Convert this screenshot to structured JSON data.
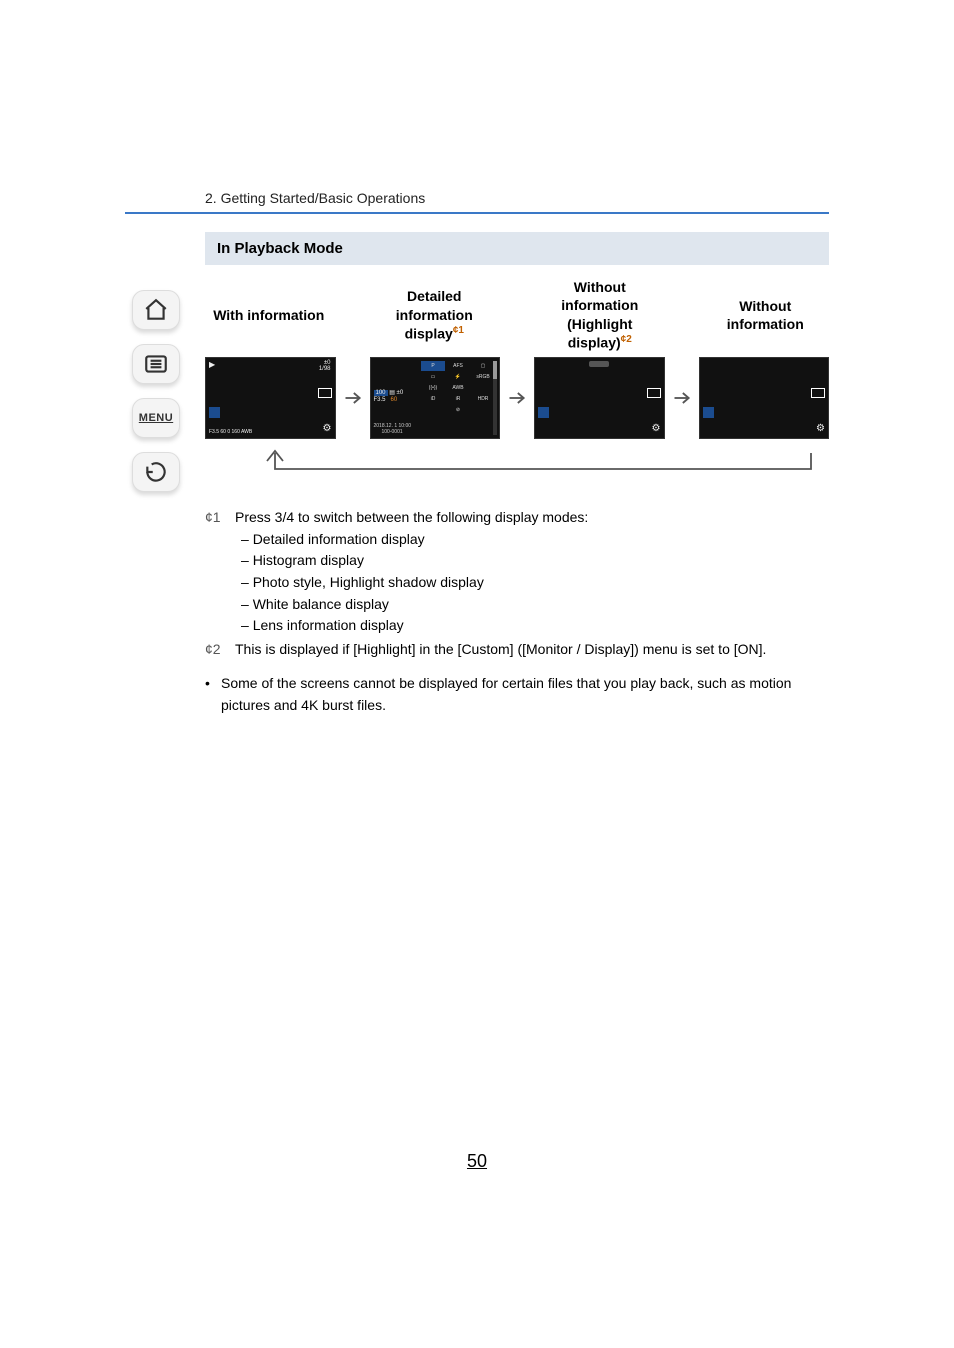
{
  "breadcrumb": "2. Getting Started/Basic Operations",
  "nav": {
    "menu_label": "MENU"
  },
  "section_title": "In Playback Mode",
  "columns": {
    "c1": "With information",
    "c2_line1": "Detailed",
    "c2_line2": "information",
    "c2_line3": "display",
    "c2_sup": "¢1",
    "c3_line1": "Without",
    "c3_line2": "information",
    "c3_line3": "(Highlight",
    "c3_line4": "display)",
    "c3_sup": "¢2",
    "c4_line1": "Without",
    "c4_line2": "information"
  },
  "thumb1": {
    "topright1": "±0",
    "topright2": "1/98",
    "play": "▶",
    "bottom": "F3.5 60  0  160  AWB"
  },
  "thumb2": {
    "p": "P",
    "afs": "AFS",
    "srgb": "sRGB",
    "awb": "AWB",
    "iso100": "100",
    "exp": "±0",
    "f": "F3.5",
    "ss": "60",
    "date": "2018.12. 1 10:00",
    "fileno": "100-0001"
  },
  "footnotes": {
    "f1_lead": "¢1",
    "f1_text": "Press 3/4 to switch between the following display modes:",
    "f1_items": [
      "Detailed information display",
      "Histogram display",
      "Photo style, Highlight shadow display",
      "White balance display",
      "Lens information display"
    ],
    "f2_lead": "¢2",
    "f2_text": "This is displayed if [Highlight] in the [Custom] ([Monitor / Display]) menu is set to [ON].",
    "bullet_text": "Some of the screens cannot be displayed for certain files that you play back, such as motion pictures and 4K burst files."
  },
  "page_number": "50"
}
